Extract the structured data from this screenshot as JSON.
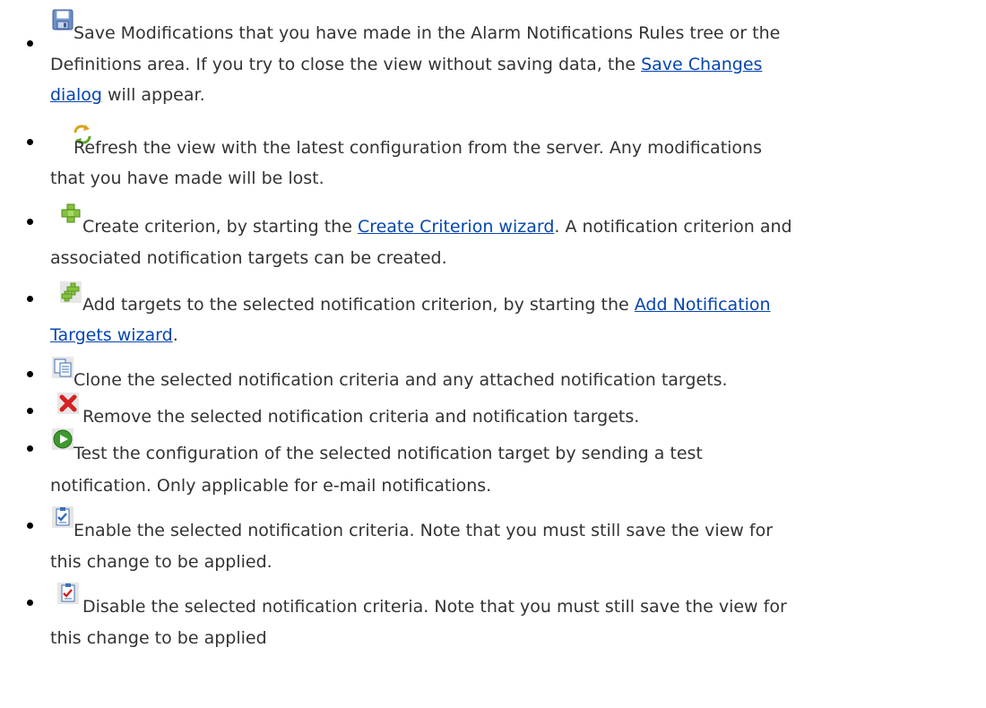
{
  "items": [
    {
      "icon": "save-icon",
      "line1_pre": "Save Modifications that you have made in the Alarm Notifications Rules tree or the",
      "line2_pre": "Definitions area. If you try to close the view without saving data, the ",
      "line2_link": "Save Changes",
      "line3_link": "dialog",
      "line3_post": " will appear."
    },
    {
      "icon": "refresh-icon",
      "line1": "Refresh the view with the latest configuration from the server. Any modifications",
      "line2": "that you have made will be lost."
    },
    {
      "icon": "create-criterion-icon",
      "line1_pre": " Create criterion, by starting the ",
      "line1_link": "Create Criterion wizard",
      "line1_post": ". A notification criterion and",
      "line2": "associated notification targets can be created."
    },
    {
      "icon": "add-targets-icon",
      "line1_pre": " Add targets to the selected notification criterion, by starting the ",
      "line1_link": "Add Notification",
      "line2_link": "Targets wizard",
      "line2_post": "."
    },
    {
      "icon": "clone-icon",
      "line1": "Clone the selected notification criteria and any attached notification targets."
    },
    {
      "icon": "remove-icon",
      "line1": " Remove the selected notification criteria and notification targets."
    },
    {
      "icon": "test-icon",
      "line1": "Test the configuration of the selected notification target by sending a test",
      "line2": "notification. Only applicable for e-mail notifications."
    },
    {
      "icon": "enable-icon",
      "line1": "Enable the selected notification criteria. Note that you must still save the view for",
      "line2": "this change to be applied."
    },
    {
      "icon": "disable-icon",
      "line1": " Disable the selected notification criteria. Note that you must still save the view for",
      "line2": "this change to be applied"
    }
  ]
}
